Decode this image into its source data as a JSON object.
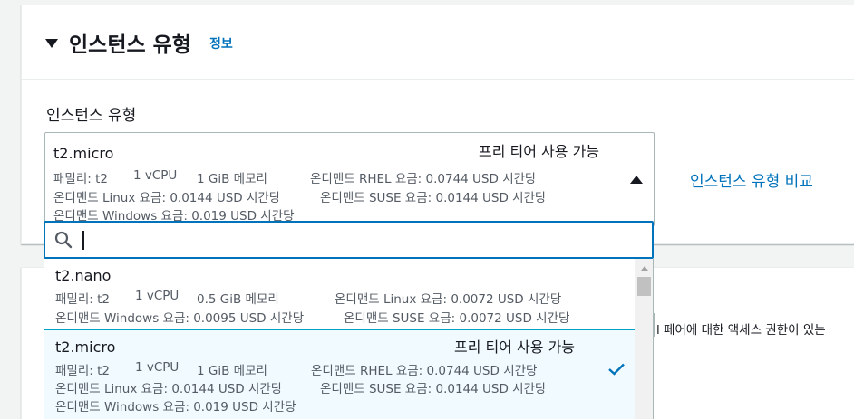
{
  "section": {
    "title": "인스턴스 유형",
    "info_link": "정보",
    "field_label": "인스턴스 유형",
    "compare_link": "인스턴스 유형 비교"
  },
  "selected": {
    "name": "t2.micro",
    "badge": "프리 티어 사용 가능",
    "line1a": "패밀리: t2",
    "line1b": "1 vCPU",
    "line1c": "1 GiB 메모리",
    "line1d": "온디맨드 RHEL 요금: 0.0744 USD 시간당",
    "line2a": "온디맨드 Linux 요금: 0.0144 USD 시간당",
    "line2b": "온디맨드 SUSE 요금: 0.0144 USD 시간당",
    "line3": "온디맨드 Windows 요금: 0.019 USD 시간당"
  },
  "search": {
    "value": "",
    "placeholder": ""
  },
  "options": [
    {
      "name": "t2.nano",
      "badge": "",
      "line1a": "패밀리: t2",
      "line1b": "1 vCPU",
      "line1c": "0.5 GiB 메모리",
      "line1d": "온디맨드 Linux 요금: 0.0072 USD 시간당",
      "line2a": "온디맨드 Windows 요금: 0.0095 USD 시간당",
      "line2b": "온디맨드 SUSE 요금: 0.0072 USD 시간당"
    },
    {
      "name": "t2.micro",
      "badge": "프리 티어 사용 가능",
      "line1a": "패밀리: t2",
      "line1b": "1 vCPU",
      "line1c": "1 GiB 메모리",
      "line1d": "온디맨드 RHEL 요금: 0.0744 USD 시간당",
      "line2a": "온디맨드 Linux 요금: 0.0144 USD 시간당",
      "line2b": "온디맨드 SUSE 요금: 0.0144 USD 시간당",
      "line3": "온디맨드 Windows 요금: 0.019 USD 시간당"
    }
  ],
  "background_panel": {
    "partial_text": "l 페어에 대한 액세스 권한이 있는"
  },
  "icons": {
    "caret": "caret-down-icon",
    "dropdown_toggle": "caret-up-icon",
    "search": "search-icon",
    "check": "check-icon"
  },
  "colors": {
    "link": "#0073bb",
    "focus_border": "#0073bb",
    "selected_bg": "#f1faff"
  }
}
